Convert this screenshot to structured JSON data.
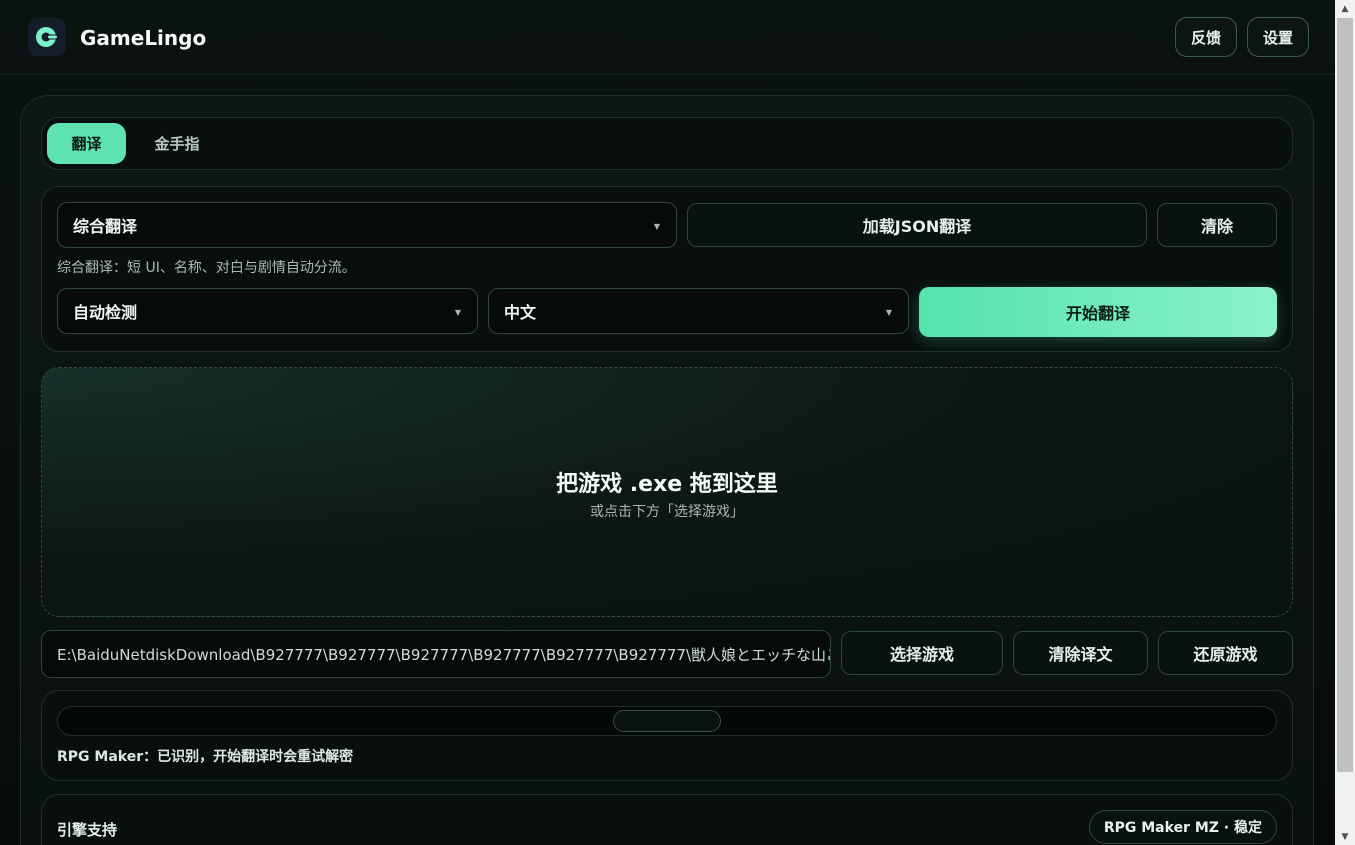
{
  "header": {
    "app_name": "GameLingo",
    "feedback_label": "反馈",
    "settings_label": "设置"
  },
  "tabs": [
    {
      "label": "翻译",
      "active": true
    },
    {
      "label": "金手指",
      "active": false
    }
  ],
  "config": {
    "mode_value": "综合翻译",
    "mode_hint": "综合翻译：短 UI、名称、对白与剧情自动分流。",
    "load_json_label": "加载JSON翻译",
    "clear_label": "清除",
    "source_lang": "自动检测",
    "target_lang": "中文",
    "start_label": "开始翻译"
  },
  "dropzone": {
    "title": "把游戏 .exe 拖到这里",
    "subtitle": "或点击下方「选择游戏」"
  },
  "game": {
    "path": "E:\\BaiduNetdiskDownload\\B927777\\B927777\\B927777\\B927777\\B927777\\B927777\\獣人娘とエッチな山ごもり",
    "select_label": "选择游戏",
    "clear_translation_label": "清除译文",
    "restore_label": "还原游戏"
  },
  "progress": {
    "status": "RPG Maker：已识别，开始翻译时会重试解密"
  },
  "engine": {
    "label": "引擎支持",
    "badge": "RPG Maker MZ · 稳定"
  },
  "colors": {
    "accent": "#5fe3b0",
    "background": "#070c0b"
  }
}
